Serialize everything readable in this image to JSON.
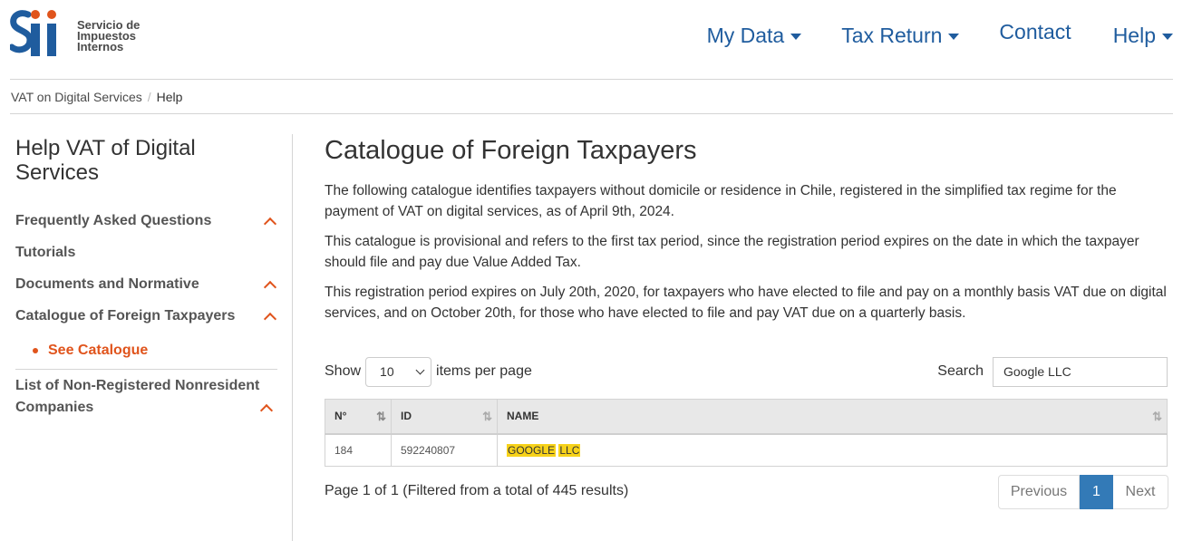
{
  "header": {
    "logo_text_lines": [
      "Servicio de",
      "Impuestos",
      "Internos"
    ],
    "logo_mark": "sii-logo",
    "nav": [
      {
        "label": "My Data",
        "has_dropdown": true
      },
      {
        "label": "Tax Return",
        "has_dropdown": true
      },
      {
        "label": "Contact",
        "has_dropdown": false
      },
      {
        "label": "Help",
        "has_dropdown": true
      }
    ]
  },
  "breadcrumb": {
    "items": [
      "VAT on Digital Services",
      "Help"
    ],
    "separator": "/"
  },
  "sidebar": {
    "title": "Help VAT of Digital Services",
    "items": [
      {
        "label": "Frequently Asked Questions",
        "expandable": true
      },
      {
        "label": "Tutorials",
        "expandable": false
      },
      {
        "label": "Documents and Normative",
        "expandable": true
      },
      {
        "label": "Catalogue of Foreign Taxpayers",
        "expandable": true
      }
    ],
    "sub_item": "See Catalogue",
    "last_item": "List of Non-Registered Nonresident Companies"
  },
  "main": {
    "title": "Catalogue of Foreign Taxpayers",
    "paragraphs": [
      "The following catalogue identifies taxpayers without domicile or residence in Chile, registered in the simplified tax regime for the payment of VAT on digital services, as of April 9th, 2024.",
      "This catalogue is provisional and refers to the first tax period, since the registration period expires on the date in which the taxpayer should file and pay due Value Added Tax.",
      "This registration period expires on July 20th, 2020, for taxpayers who have elected to file and pay on a monthly basis VAT due on digital services, and on October 20th, for those who have elected to file and pay VAT due on a quarterly basis."
    ]
  },
  "controls": {
    "show_label": "Show",
    "page_size": "10",
    "per_page_label": "items per page",
    "search_label": "Search",
    "search_value": "Google LLC"
  },
  "table": {
    "columns": [
      "N°",
      "ID",
      "NAME"
    ],
    "rows": [
      {
        "n": "184",
        "id": "592240807",
        "name_parts": [
          "GOOGLE",
          "LLC"
        ]
      }
    ]
  },
  "pagination": {
    "info": "Page 1 of 1 (Filtered from a total of 445 results)",
    "previous": "Previous",
    "current": "1",
    "next": "Next"
  },
  "colors": {
    "nav_blue": "#1f5c9e",
    "accent_orange": "#e0541c",
    "pager_active": "#337ab7",
    "highlight": "#f7d21a"
  }
}
